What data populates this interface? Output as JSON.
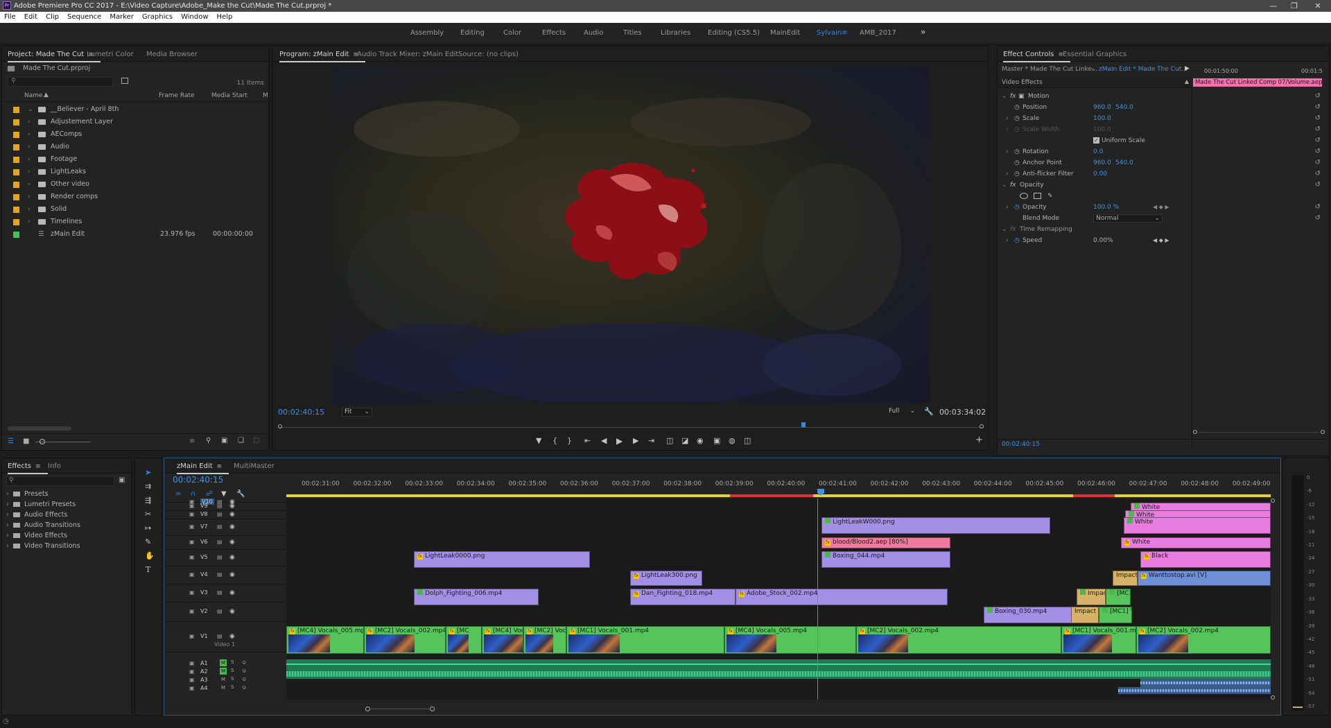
{
  "window": {
    "title": "Adobe Premiere Pro CC 2017 - E:\\Video Capture\\Adobe_Make the Cut\\Made The Cut.prproj *",
    "app_icon": "Pr"
  },
  "menu": [
    "File",
    "Edit",
    "Clip",
    "Sequence",
    "Marker",
    "Graphics",
    "Window",
    "Help"
  ],
  "workspaces": [
    "Assembly",
    "Editing",
    "Color",
    "Effects",
    "Audio",
    "Titles",
    "Libraries",
    "Editing (CS5.5)",
    "MainEdit",
    "Sylvain",
    "AMB_2017"
  ],
  "active_workspace": "Sylvain",
  "project_panel": {
    "tabs": [
      "Project: Made The Cut",
      "Lumetri Color",
      "Media Browser"
    ],
    "project_file": "Made The Cut.prproj",
    "item_count": "11 Items",
    "columns": [
      "Name",
      "Frame Rate",
      "Media Start",
      "M"
    ],
    "items": [
      {
        "name": "__Believer - April 8th",
        "expanded": true,
        "color": "#e8a21f"
      },
      {
        "name": "Adjustement Layer",
        "color": "#e8a21f"
      },
      {
        "name": "AEComps",
        "color": "#e8a21f"
      },
      {
        "name": "Audio",
        "color": "#e8a21f"
      },
      {
        "name": "Footage",
        "color": "#e8a21f"
      },
      {
        "name": "LightLeaks",
        "color": "#e8a21f"
      },
      {
        "name": "Other video",
        "color": "#e8a21f"
      },
      {
        "name": "Render comps",
        "color": "#e8a21f"
      },
      {
        "name": "Solid",
        "color": "#e8a21f"
      },
      {
        "name": "Timelines",
        "color": "#e8a21f"
      },
      {
        "name": "zMain Edit",
        "frame_rate": "23.976 fps",
        "media_start": "00:00:00:00",
        "color": "#3fc45a",
        "is_sequence": true
      }
    ]
  },
  "program_monitor": {
    "tabs": [
      "Program: zMain Edit",
      "Audio Track Mixer: zMain Edit",
      "Source: (no clips)"
    ],
    "timecode": "00:02:40:15",
    "fit": "Fit",
    "resolution": "Full",
    "duration": "00:03:34:02",
    "playhead_fraction": 0.745
  },
  "effect_controls": {
    "tabs": [
      "Effect Controls",
      "Essential Graphics"
    ],
    "master": "Master * Made The Cut Linke...",
    "sequence_clip": "zMain Edit * Made The Cut...",
    "ruler_time": "00:01:50:00",
    "ruler_time2": "00:01:5",
    "clip_bar": "Made The Cut Linked Comp 07/Volume.aep",
    "section": "Video Effects",
    "motion": "Motion",
    "position_label": "Position",
    "position_x": "960.0",
    "position_y": "540.0",
    "scale_label": "Scale",
    "scale": "100.0",
    "scale_width_label": "Scale Width",
    "scale_width": "100.0",
    "uniform_scale": "Uniform Scale",
    "rotation_label": "Rotation",
    "rotation": "0.0",
    "anchor_label": "Anchor Point",
    "anchor_x": "960.0",
    "anchor_y": "540.0",
    "antiflicker_label": "Anti-flicker Filter",
    "antiflicker": "0.00",
    "opacity_section": "Opacity",
    "opacity_label": "Opacity",
    "opacity": "100.0 %",
    "blend_label": "Blend Mode",
    "blend": "Normal",
    "time_remap": "Time Remapping",
    "speed_label": "Speed",
    "speed": "0.00%",
    "footer_time": "00:02:40:15"
  },
  "effects_panel": {
    "tabs": [
      "Effects",
      "Info"
    ],
    "items": [
      "Presets",
      "Lumetri Presets",
      "Audio Effects",
      "Audio Transitions",
      "Video Effects",
      "Video Transitions"
    ]
  },
  "timeline": {
    "tabs": [
      "zMain Edit",
      "MultiMaster"
    ],
    "timecode": "00:02:40:15",
    "ruler": [
      "00:02:31:00",
      "00:02:32:00",
      "00:02:33:00",
      "00:02:34:00",
      "00:02:35:00",
      "00:02:36:00",
      "00:02:37:00",
      "00:02:38:00",
      "00:02:39:00",
      "00:02:40:00",
      "00:02:41:00",
      "00:02:42:00",
      "00:02:43:00",
      "00:02:44:00",
      "00:02:45:00",
      "00:02:46:00",
      "00:02:47:00",
      "00:02:48:00",
      "00:02:49:00"
    ],
    "video_tracks": [
      "V10",
      "V9",
      "V8",
      "V7",
      "V6",
      "V5",
      "V4",
      "V3",
      "V2",
      "V1"
    ],
    "v1_name": "Video 1",
    "audio_tracks": [
      "A1",
      "A2",
      "A3",
      "A4"
    ],
    "meter_scale": [
      "0",
      "-6",
      "-12",
      "-15",
      "-18",
      "-21",
      "-24",
      "-27",
      "-30",
      "-33",
      "-36",
      "-39",
      "-42",
      "-45",
      "-48",
      "-51",
      "-54",
      "-57"
    ],
    "clips": {
      "lightleak0000": "LightLeak0000.png",
      "lightleak300": "LightLeak300.png",
      "lightleakw000": "LightLeakW000.png",
      "blood": "blood/Blood2.aep [80%]",
      "boxing044": "Boxing_044.mp4",
      "dolph": "Dolph_Fighting_006.mp4",
      "dan": "Dan_Fighting_018.mp4",
      "adobe_stock": "Adobe_Stock_002.mp4",
      "boxing030": "Boxing_030.mp4",
      "white1": "White",
      "white2": "White",
      "white3": "White",
      "white4": "White",
      "black": "Black",
      "wanttostop": "Wanttostop.avi [V]",
      "impact1": "Impact F",
      "impact2": "Impact C",
      "impact3": "Impact C",
      "mc1a": "[MC1] V",
      "mc1b": "[MC1] Voc",
      "v1_1": "[MC4] Vocals_005.mp4",
      "v1_2": "[MC2] Vocals_002.mp4",
      "v1_3": "[MC",
      "v1_4": "[MC4] Voca",
      "v1_5": "[MC2] Vocals",
      "v1_6": "[MC1] Vocals_001.mp4",
      "v1_7": "[MC4] Vocals_005.mp4",
      "v1_8": "[MC2] Vocals_002.mp4",
      "v1_9": "[MC1] Vocals_001.m",
      "v1_10": "[MC2] Vocals_002.mp4"
    }
  },
  "colors": {
    "accent_blue": "#2d8ceb",
    "clip_purple": "#a28fe6",
    "clip_green": "#55c45a",
    "clip_pink": "#e87ce0",
    "clip_red": "#f07aa0",
    "audio_green": "#1f7a52",
    "clip_steel": "#6f8fd6",
    "clip_tan": "#d9b26a"
  }
}
